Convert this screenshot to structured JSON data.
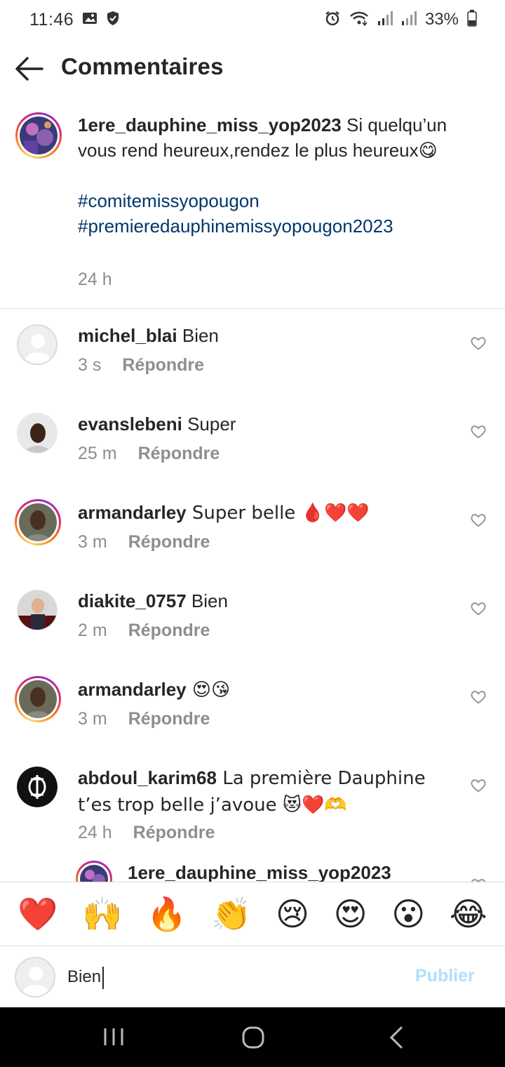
{
  "status_bar": {
    "time": "11:46",
    "battery": "33%",
    "icons": [
      "gallery-icon",
      "shield-icon",
      "alarm-icon",
      "wifi-icon",
      "signal-icon",
      "signal-icon",
      "battery-icon"
    ]
  },
  "header": {
    "title": "Commentaires"
  },
  "caption": {
    "username": "1ere_dauphine_miss_yop2023",
    "text": " Si quelqu’un vous rend heureux,rendez le plus heureux😋",
    "hashtags": [
      "#comitemissyopougon",
      "#premieredauphinemissyopougon2023"
    ],
    "time": "24 h"
  },
  "comments": [
    {
      "username": "michel_blai",
      "text": " Bien",
      "time": "3 s",
      "reply": "Répondre"
    },
    {
      "username": "evanslebeni",
      "text": " Super",
      "time": "25 m",
      "reply": "Répondre"
    },
    {
      "username": "armandarley",
      "text": " Super belle 🩸❤️❤️",
      "time": "3 m",
      "reply": "Répondre"
    },
    {
      "username": "diakite_0757",
      "text": " Bien",
      "time": "2 m",
      "reply": "Répondre"
    },
    {
      "username": "armandarley",
      "text": " 😍😘",
      "time": "3 m",
      "reply": "Répondre"
    },
    {
      "username": "abdoul_karim68",
      "text": " La première Dauphine t’es trop belle j’avoue 😻❤️🫶",
      "time": "24 h",
      "reply": "Répondre"
    }
  ],
  "partial_comment": {
    "username": "1ere_dauphine_miss_yop2023"
  },
  "emoji_bar": [
    "❤️",
    "🙌",
    "🔥",
    "👏",
    "😢",
    "😍",
    "😮",
    "😂"
  ],
  "input": {
    "value": "Bien",
    "publish_label": "Publier"
  },
  "colors": {
    "hashtag": "#00376b",
    "muted": "#8e8e8e",
    "publish_disabled": "#b2dffc"
  }
}
